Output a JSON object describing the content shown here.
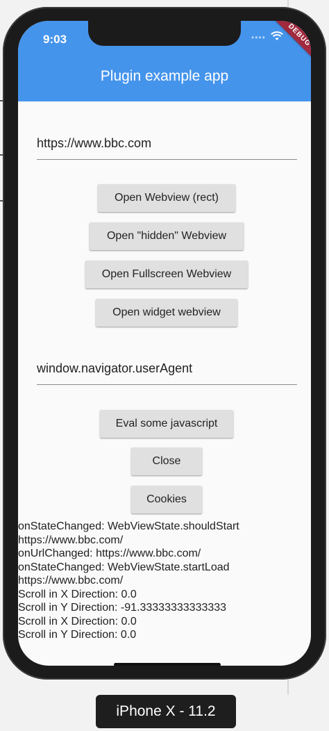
{
  "status_bar": {
    "time": "9:03",
    "debug_banner": "DEBUG"
  },
  "app_bar": {
    "title": "Plugin example app"
  },
  "url_input": {
    "value": "https://www.bbc.com"
  },
  "buttons": {
    "open_rect": "Open Webview (rect)",
    "open_hidden": "Open \"hidden\" Webview",
    "open_fullscreen": "Open Fullscreen Webview",
    "open_widget": "Open widget webview",
    "eval_js": "Eval some javascript",
    "close": "Close",
    "cookies": "Cookies"
  },
  "js_input": {
    "value": "window.navigator.userAgent"
  },
  "log": [
    "onStateChanged: WebViewState.shouldStart",
    "https://www.bbc.com/",
    "onUrlChanged: https://www.bbc.com/",
    "onStateChanged: WebViewState.startLoad",
    "https://www.bbc.com/",
    "Scroll in X Direction: 0.0",
    "Scroll in Y Direction: -91.33333333333333",
    "Scroll in X Direction: 0.0",
    "Scroll in Y Direction: 0.0"
  ],
  "simulator": {
    "device_label": "iPhone X - 11.2"
  },
  "colors": {
    "app_bar": "#4594ec",
    "debug_banner": "#a12a3e",
    "button": "#e0e0e0"
  }
}
